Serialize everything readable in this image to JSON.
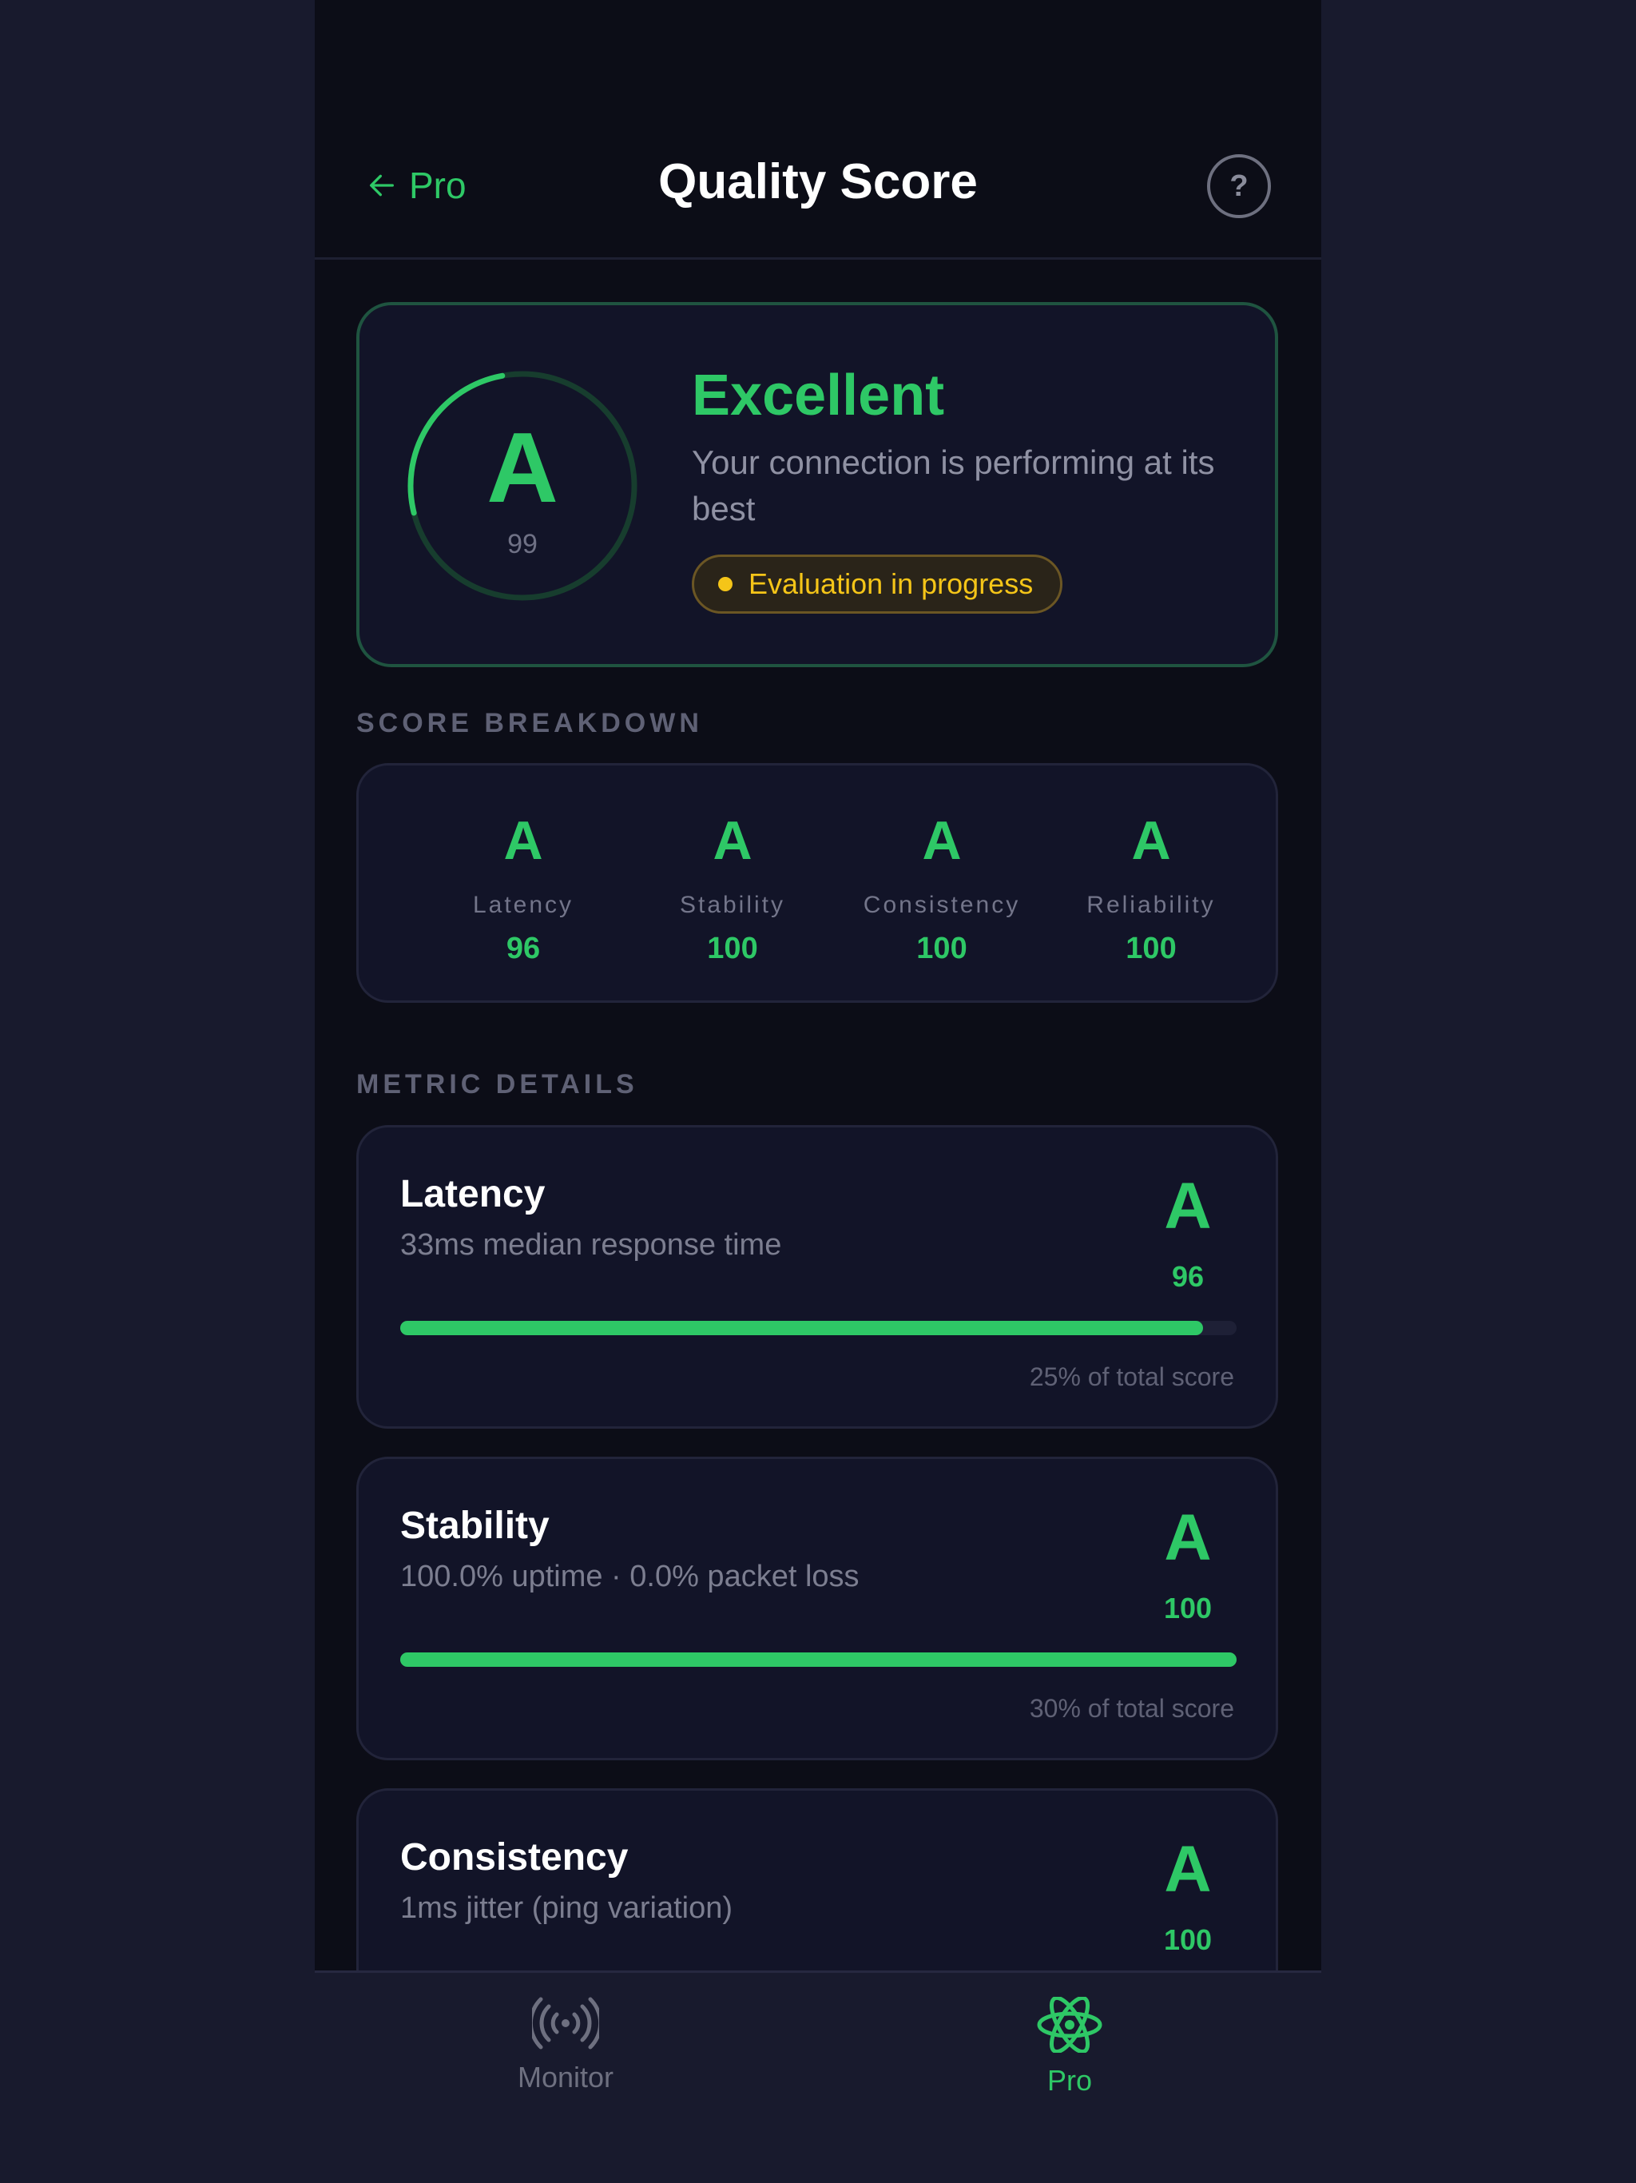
{
  "header": {
    "back_label": "Pro",
    "title": "Quality Score",
    "help_label": "?"
  },
  "hero": {
    "grade": "A",
    "score": "99",
    "score_fraction": 0.99,
    "title": "Excellent",
    "description": "Your connection is performing at its best",
    "status": "Evaluation in progress"
  },
  "breakdown": {
    "section_label": "SCORE BREAKDOWN",
    "items": [
      {
        "grade": "A",
        "name": "Latency",
        "score": "96"
      },
      {
        "grade": "A",
        "name": "Stability",
        "score": "100"
      },
      {
        "grade": "A",
        "name": "Consistency",
        "score": "100"
      },
      {
        "grade": "A",
        "name": "Reliability",
        "score": "100"
      }
    ]
  },
  "metrics": {
    "section_label": "METRIC DETAILS",
    "items": [
      {
        "name": "Latency",
        "description": "33ms median response time",
        "grade": "A",
        "score": "96",
        "progress": 0.96,
        "weight": "25% of total score"
      },
      {
        "name": "Stability",
        "description": "100.0% uptime · 0.0% packet loss",
        "grade": "A",
        "score": "100",
        "progress": 1.0,
        "weight": "30% of total score"
      },
      {
        "name": "Consistency",
        "description": "1ms jitter (ping variation)",
        "grade": "A",
        "score": "100"
      }
    ]
  },
  "tabs": [
    {
      "label": "Monitor",
      "icon": "broadcast-icon",
      "active": false
    },
    {
      "label": "Pro",
      "icon": "atom-icon",
      "active": true
    }
  ],
  "colors": {
    "accent": "#2ec866",
    "warning": "#f5c518",
    "inactive": "#6e7080"
  }
}
